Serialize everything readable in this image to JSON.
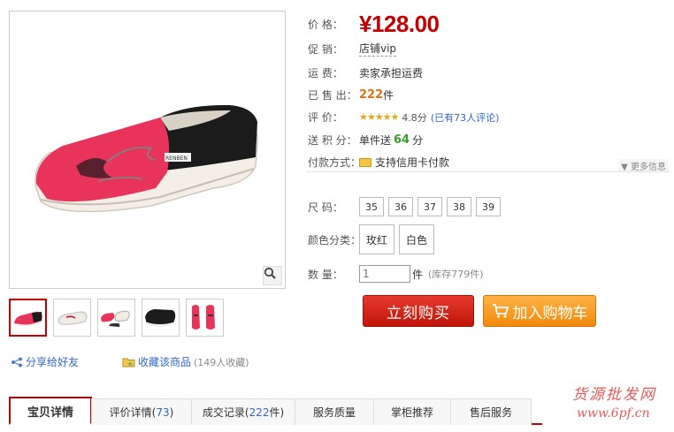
{
  "product": {
    "price_label": "价 格：",
    "price": "¥128.00",
    "promo_label": "促 销：",
    "promo_value": "店铺vip",
    "shipping_label": "运 费：",
    "shipping_value": "卖家承担运费",
    "sold_label": "已 售 出：",
    "sold_count": "222",
    "sold_unit": "件",
    "rating_label": "评 价：",
    "rating_stars": "★★★★★",
    "rating_score": "4.8分",
    "rating_link": "(已有73人评论)",
    "points_label": "送 积 分：",
    "points_prefix": "单件送",
    "points_value": "64",
    "points_unit": "分",
    "payment_label": "付款方式：",
    "payment_value": "支持信用卡付款",
    "more_info": "更多信息"
  },
  "options": {
    "size_label": "尺 码：",
    "sizes": [
      "35",
      "36",
      "37",
      "38",
      "39"
    ],
    "color_label": "颜色分类：",
    "colors": [
      "玫红",
      "白色"
    ],
    "qty_label": "数 量：",
    "qty_value": "1",
    "qty_unit": "件",
    "stock": "(库存779件)"
  },
  "actions": {
    "buy_label": "立刻购买",
    "cart_label": "加入购物车",
    "share_label": "分享给好友",
    "fav_label": "收藏该商品",
    "fav_count": "(149人收藏)"
  },
  "tabs": [
    {
      "label": "宝贝详情",
      "num": ""
    },
    {
      "label": "评价详情(",
      "num": "73",
      "suffix": ")"
    },
    {
      "label": "成交记录(",
      "num": "222",
      "suffix": "件)"
    },
    {
      "label": "服务质量",
      "num": ""
    },
    {
      "label": "掌柜推荐",
      "num": ""
    },
    {
      "label": "售后服务",
      "num": ""
    }
  ],
  "image": {
    "shoe_brand": "RENBEN"
  },
  "watermark": {
    "line1": "货源批发网",
    "line2": "www.6pf.cn"
  },
  "colors": {
    "price_red": "#c40000",
    "shoe_pink": "#e8345a",
    "link_blue": "#3366cc"
  }
}
